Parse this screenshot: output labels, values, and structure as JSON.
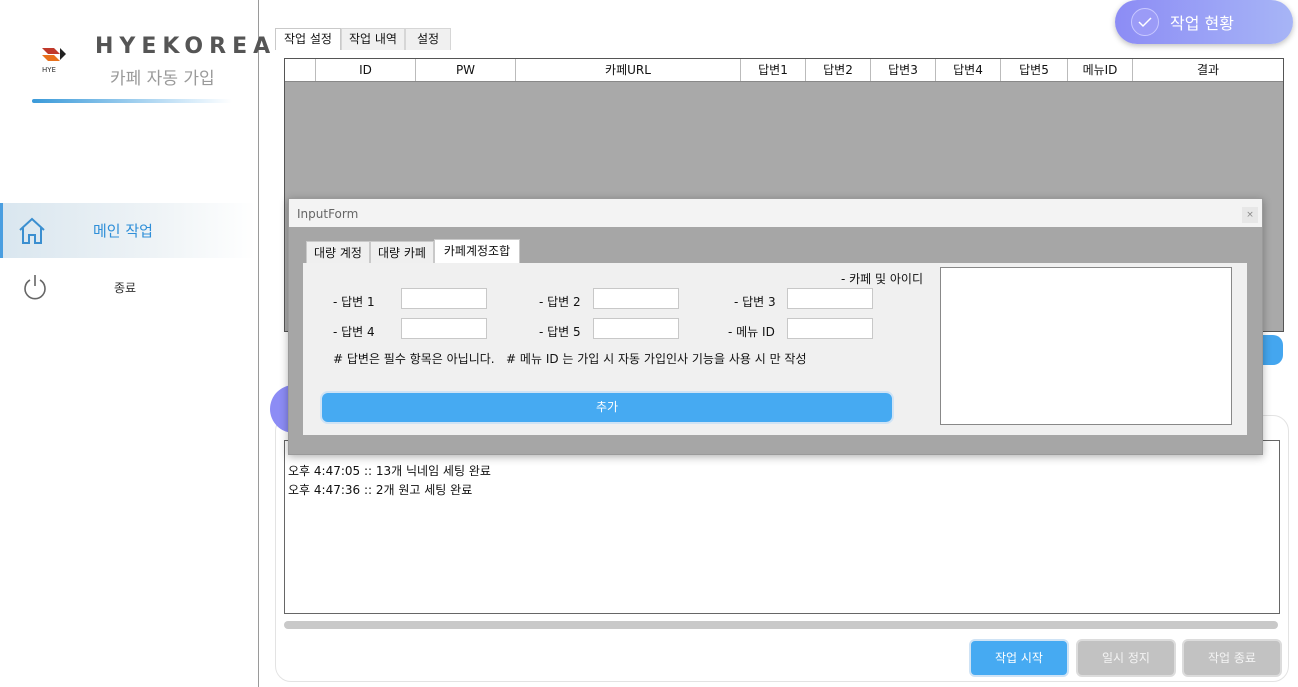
{
  "brand": {
    "name": "HYEKOREA",
    "subtitle": "카페 자동 가입",
    "logo_text": "HYE"
  },
  "nav": {
    "main": "메인 작업",
    "exit": "종료"
  },
  "status_button": "작업 현황",
  "tabs": [
    "작업 설정",
    "작업 내역",
    "설정"
  ],
  "grid": {
    "columns": [
      "",
      "ID",
      "PW",
      "카페URL",
      "답변1",
      "답변2",
      "답변3",
      "답변4",
      "답변5",
      "메뉴ID",
      "결과"
    ]
  },
  "log": {
    "lines": [
      "오후 4:47:05 ::  13개 닉네임 세팅 완료",
      "오후 4:47:36 ::  2개 원고 세팅 완료"
    ]
  },
  "buttons": {
    "start": "작업 시작",
    "pause": "일시 정지",
    "stop": "작업 종료"
  },
  "colors": {
    "accent": "#46aaf2",
    "purple": "#8c8cf5",
    "disabled": "#c2c2c2"
  },
  "dialog": {
    "title": "InputForm",
    "tabs": [
      "대량 계정",
      "대량 카페",
      "카페계정조합"
    ],
    "fields": {
      "answer1": "- 답변 1",
      "answer2": "- 답변 2",
      "answer3": "- 답변 3",
      "answer4": "- 답변 4",
      "answer5": "- 답변 5",
      "menu_id": "- 메뉴 ID"
    },
    "cafe_id_label": "- 카페 및 아이디",
    "note": "# 답변은 필수 항목은 아닙니다.   # 메뉴 ID 는 가입 시 자동 가입인사 기능을 사용 시 만 작성",
    "add_button": "추가"
  }
}
